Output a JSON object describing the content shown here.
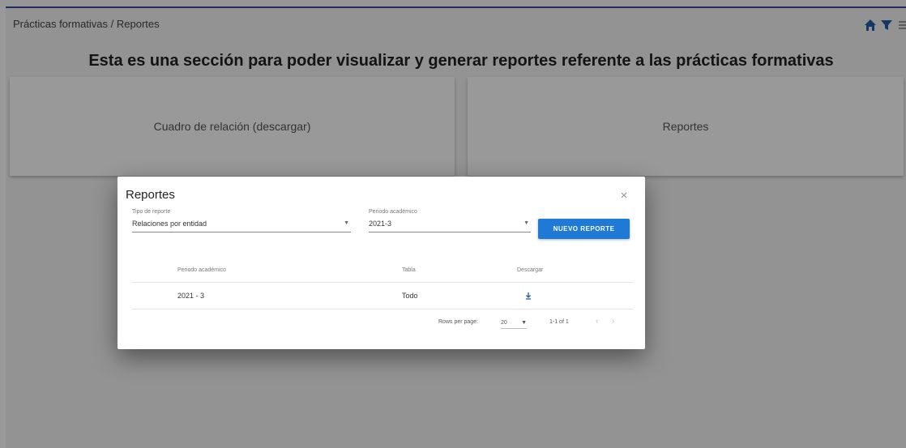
{
  "breadcrumb": "Prácticas formativas / Reportes",
  "header": {
    "icons": [
      "home-icon",
      "filter-icon",
      "menu-icon"
    ]
  },
  "headline": "Esta es una sección para poder visualizar y generar reportes referente a las prácticas formativas",
  "cards": {
    "left_label": "Cuadro de relación (descargar)",
    "right_label": "Reportes"
  },
  "dialog": {
    "title": "Reportes",
    "close_icon": "close-icon",
    "field1": {
      "label": "Tipo de reporte",
      "value": "Relaciones por entidad"
    },
    "field2": {
      "label": "Periodo académico",
      "value": "2021-3"
    },
    "new_button": "NUEVO REPORTE",
    "table": {
      "headers": [
        "Periodo académico",
        "Tabla",
        "Descargar"
      ],
      "rows": [
        {
          "period": "2021 - 3",
          "table": "Todo"
        }
      ]
    },
    "pagination": {
      "rows_label": "Rows per page:",
      "rows_value": "20",
      "range": "1-1 of 1"
    }
  },
  "colors": {
    "accent": "#1e7ad6",
    "topbar": "#3949ab",
    "icon": "#1e5fa8"
  }
}
